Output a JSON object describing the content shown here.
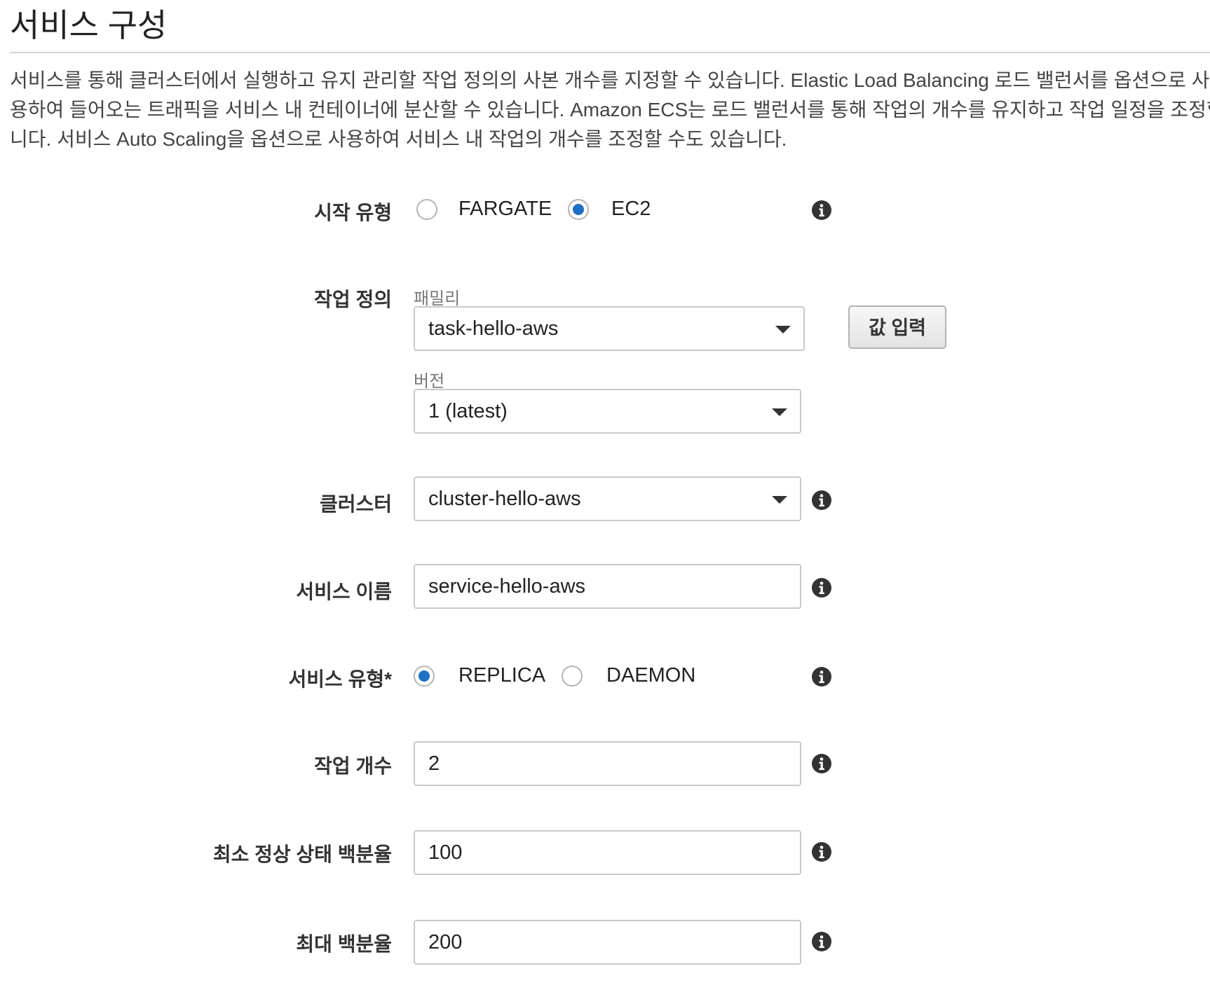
{
  "page": {
    "title": "서비스 구성",
    "description_lines": [
      "서비스를 통해 클러스터에서 실행하고 유지 관리할 작업 정의의 사본 개수를 지정할 수 있습니다. Elastic Load Balancing 로드 밸런서를 옵션으로 사",
      "용하여 들어오는 트래픽을 서비스 내 컨테이너에 분산할 수 있습니다. Amazon ECS는 로드 밸런서를 통해 작업의 개수를 유지하고 작업 일정을 조정합",
      "니다. 서비스 Auto Scaling을 옵션으로 사용하여 서비스 내 작업의 개수를 조정할 수도 있습니다."
    ]
  },
  "launch_type": {
    "label": "시작 유형",
    "options": [
      "FARGATE",
      "EC2"
    ],
    "selected": "EC2",
    "info_icon": "info-icon"
  },
  "task_definition": {
    "label": "작업 정의",
    "family_label": "패밀리",
    "family_value": "task-hello-aws",
    "enter_value_button": "값 입력",
    "revision_label": "버전",
    "revision_value": "1 (latest)"
  },
  "cluster": {
    "label": "클러스터",
    "value": "cluster-hello-aws",
    "info_icon": "info-icon"
  },
  "service_name": {
    "label": "서비스 이름",
    "value": "service-hello-aws",
    "info_icon": "info-icon"
  },
  "service_type": {
    "label": "서비스 유형*",
    "options": [
      "REPLICA",
      "DAEMON"
    ],
    "selected": "REPLICA",
    "info_icon": "info-icon"
  },
  "number_of_tasks": {
    "label": "작업 개수",
    "value": "2",
    "info_icon": "info-icon"
  },
  "min_healthy_percent": {
    "label": "최소 정상 상태 백분율",
    "value": "100",
    "info_icon": "info-icon"
  },
  "max_percent": {
    "label": "최대 백분율",
    "value": "200",
    "info_icon": "info-icon"
  },
  "colors": {
    "radio_selected": "#1f6fc6",
    "border": "#c9c9c9",
    "text": "#222222"
  }
}
